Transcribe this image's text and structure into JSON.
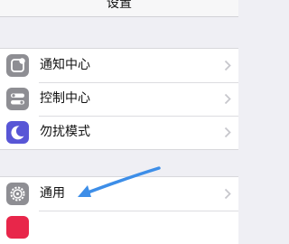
{
  "header": {
    "title": "设置"
  },
  "groups": [
    {
      "items": [
        {
          "label": "通知中心",
          "icon": "notification-center-icon",
          "icon_color": "#8e8e93"
        },
        {
          "label": "控制中心",
          "icon": "control-center-icon",
          "icon_color": "#8e8e93"
        },
        {
          "label": "勿扰模式",
          "icon": "do-not-disturb-moon-icon",
          "icon_color": "#5856d6"
        }
      ]
    },
    {
      "items": [
        {
          "label": "通用",
          "icon": "general-gear-icon",
          "icon_color": "#8e8e93"
        },
        {
          "label": "",
          "icon": "display-icon",
          "icon_color": "#e8264a"
        }
      ]
    }
  ],
  "annotation": {
    "arrow_color": "#3d8ee8"
  }
}
